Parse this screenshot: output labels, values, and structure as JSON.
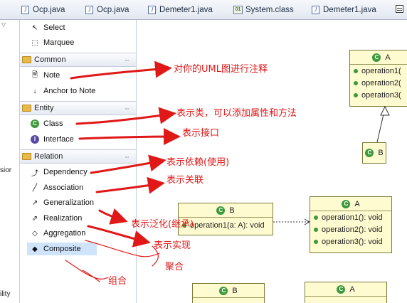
{
  "tabs": [
    {
      "label": "Ocp.java",
      "kind": "java"
    },
    {
      "label": "Ocp.java",
      "kind": "java"
    },
    {
      "label": "Demeter1.java",
      "kind": "java"
    },
    {
      "label": "System.class",
      "kind": "class"
    },
    {
      "label": "Demeter1.java",
      "kind": "java"
    }
  ],
  "sliver": {
    "text1": "sior",
    "text2": "ility"
  },
  "palette": {
    "tools": {
      "select": "Select",
      "marquee": "Marquee"
    },
    "common": {
      "title": "Common",
      "items": {
        "note": "Note",
        "anchor": "Anchor to Note"
      }
    },
    "entity": {
      "title": "Entity",
      "items": {
        "class": "Class",
        "interface": "Interface"
      }
    },
    "relation": {
      "title": "Relation",
      "items": {
        "dependency": "Dependency",
        "association": "Association",
        "generalization": "Generalization",
        "realization": "Realization",
        "aggregation": "Aggregation",
        "composite": "Composite"
      }
    }
  },
  "canvas": {
    "class_a1": {
      "name": "A",
      "ops": [
        "operation1(",
        "operation2(",
        "operation3("
      ]
    },
    "class_b_small": {
      "name": "B"
    },
    "class_b2": {
      "name": "B",
      "ops": [
        "operation1(a: A): void"
      ]
    },
    "class_a2": {
      "name": "A",
      "ops": [
        "operation1(): void",
        "operation2(): void",
        "operation3(): void"
      ]
    },
    "class_b3": {
      "name": "B"
    },
    "class_a3": {
      "name": "A"
    }
  },
  "annotations": {
    "note": "对你的UML图进行注释",
    "class": "表示类，可以添加属性和方法",
    "interface": "表示接口",
    "dependency": "表示依赖(使用)",
    "association": "表示关联",
    "generalization": "表示泛化(继承)",
    "realization": "表示实现",
    "aggregation": "聚合",
    "composite": "组合"
  },
  "colors": {
    "annotation": "#e01818",
    "class_fill": "#fffbd1",
    "selection": "#cfe3fb"
  }
}
